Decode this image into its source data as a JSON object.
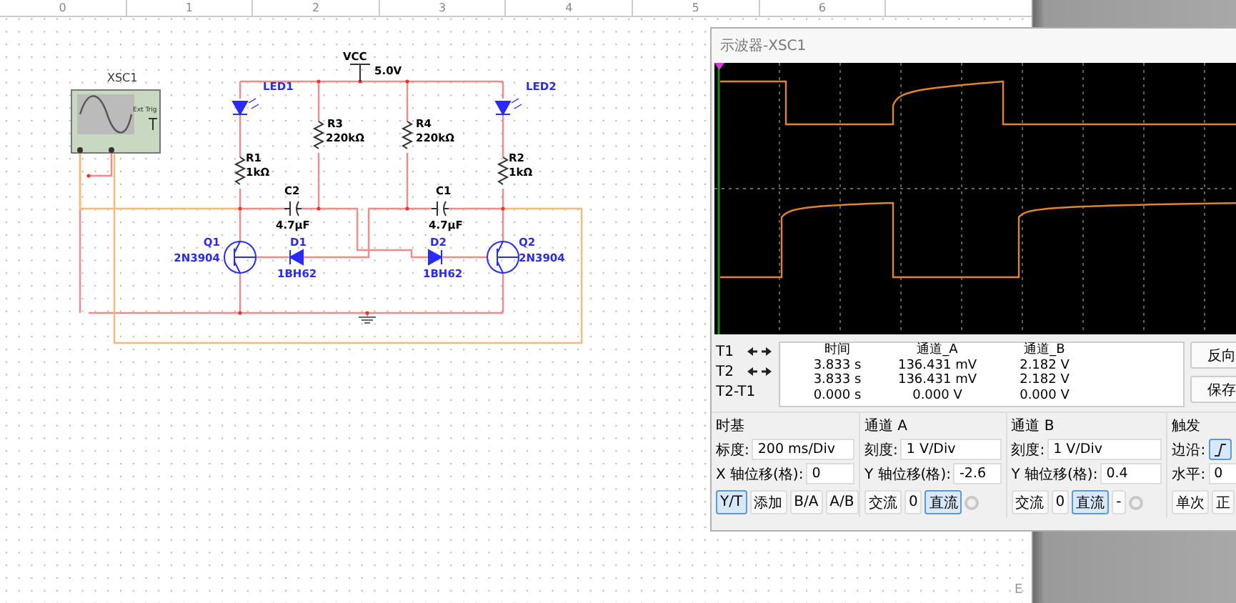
{
  "ruler": {
    "labels": [
      "0",
      "1",
      "2",
      "3",
      "4",
      "5",
      "6"
    ],
    "corner_label": "E"
  },
  "schematic": {
    "components": [
      {
        "kind": "scope",
        "ref": "XSC1",
        "value": "Ext Trig"
      },
      {
        "kind": "vcc",
        "ref": "VCC",
        "value": "5.0V"
      },
      {
        "kind": "led",
        "ref": "LED1"
      },
      {
        "kind": "resistor",
        "ref": "R3",
        "value": "220kΩ"
      },
      {
        "kind": "resistor",
        "ref": "R4",
        "value": "220kΩ"
      },
      {
        "kind": "led",
        "ref": "LED2"
      },
      {
        "kind": "resistor",
        "ref": "R1",
        "value": "1kΩ"
      },
      {
        "kind": "resistor",
        "ref": "R2",
        "value": "1kΩ"
      },
      {
        "kind": "capacitor",
        "ref": "C2",
        "value": "4.7µF"
      },
      {
        "kind": "capacitor",
        "ref": "C1",
        "value": "4.7µF"
      },
      {
        "kind": "transistor",
        "ref": "Q1",
        "value": "2N3904"
      },
      {
        "kind": "diode",
        "ref": "D1",
        "value": "1BH62"
      },
      {
        "kind": "diode",
        "ref": "D2",
        "value": "1BH62"
      },
      {
        "kind": "transistor",
        "ref": "Q2",
        "value": "2N3904"
      },
      {
        "kind": "ground"
      }
    ]
  },
  "scope_window": {
    "title": "示波器-XSC1",
    "cursors": {
      "rows": [
        "T1",
        "T2",
        "T2-T1"
      ],
      "columns": [
        "时间",
        "通道_A",
        "通道_B"
      ],
      "values": [
        [
          "3.833 s",
          "136.431 mV",
          "2.182 V"
        ],
        [
          "3.833 s",
          "136.431 mV",
          "2.182 V"
        ],
        [
          "0.000 s",
          "0.000 V",
          "0.000 V"
        ]
      ]
    },
    "side_buttons": [
      "反向",
      "保存"
    ],
    "groups": [
      {
        "title": "时基",
        "fields": [
          {
            "label": "标度:",
            "value": "200 ms/Div"
          },
          {
            "label": "X 轴位移(格):",
            "value": "0"
          }
        ],
        "buttons": [
          {
            "kind": "button",
            "label": "Y/T",
            "selected": true
          },
          {
            "kind": "button",
            "label": "添加",
            "selected": false
          },
          {
            "kind": "button",
            "label": "B/A",
            "selected": false
          },
          {
            "kind": "button",
            "label": "A/B",
            "selected": false
          }
        ]
      },
      {
        "title": "通道 A",
        "fields": [
          {
            "label": "刻度:",
            "value": "1  V/Div"
          },
          {
            "label": "Y 轴位移(格):",
            "value": "-2.6"
          }
        ],
        "buttons": [
          {
            "kind": "button",
            "label": "交流",
            "selected": false
          },
          {
            "kind": "button",
            "label": "0",
            "selected": false
          },
          {
            "kind": "button",
            "label": "直流",
            "selected": true
          },
          {
            "kind": "radio"
          }
        ]
      },
      {
        "title": "通道 B",
        "fields": [
          {
            "label": "刻度:",
            "value": "1  V/Div"
          },
          {
            "label": "Y 轴位移(格):",
            "value": "0.4"
          }
        ],
        "buttons": [
          {
            "kind": "button",
            "label": "交流",
            "selected": false
          },
          {
            "kind": "button",
            "label": "0",
            "selected": false
          },
          {
            "kind": "button",
            "label": "直流",
            "selected": true
          },
          {
            "kind": "button",
            "label": "-",
            "selected": false
          },
          {
            "kind": "radio"
          }
        ]
      },
      {
        "title": "触发",
        "fields": [
          {
            "label": "边沿:",
            "kind": "edge",
            "selected": true
          },
          {
            "label": "水平:",
            "value": "0"
          }
        ],
        "buttons": [
          {
            "kind": "button",
            "label": "单次",
            "selected": false
          },
          {
            "kind": "button",
            "label": "正",
            "selected": false
          }
        ]
      }
    ]
  }
}
